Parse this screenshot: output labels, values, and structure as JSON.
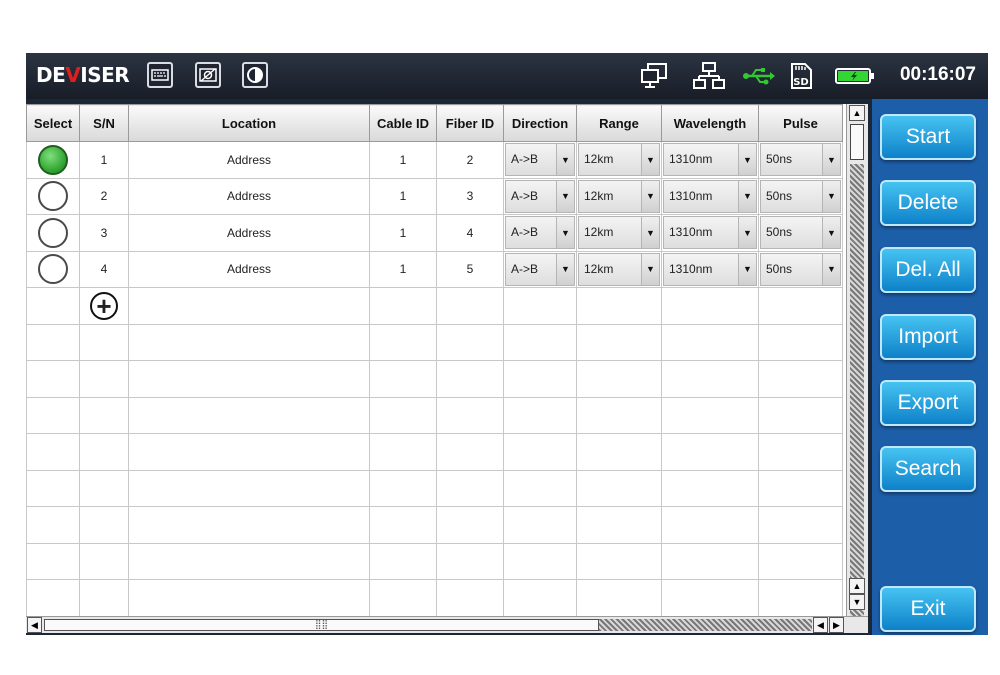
{
  "app": {
    "brand_prefix": "DE",
    "brand_mark": "V",
    "brand_suffix": "ISER",
    "clock": "00:16:07"
  },
  "colors": {
    "brand_red": "#e01e1e",
    "sidebar": "#1d5ea8",
    "button": "#2aa7e6",
    "selected": "#2ba02b",
    "usb_icon": "#32c832",
    "battery_fill": "#33d633"
  },
  "toolbar": {
    "icons": [
      "keyboard-icon",
      "screenshot-icon",
      "contrast-icon"
    ]
  },
  "status": {
    "icons": [
      "display-icon",
      "network-icon",
      "usb-icon",
      "sd-card-icon",
      "battery-icon"
    ],
    "sd_label": "SD"
  },
  "table": {
    "headers": {
      "select": "Select",
      "sn": "S/N",
      "location": "Location",
      "cable_id": "Cable ID",
      "fiber_id": "Fiber ID",
      "direction": "Direction",
      "range": "Range",
      "wavelength": "Wavelength",
      "pulse": "Pulse"
    },
    "rows": [
      {
        "selected": true,
        "sn": "1",
        "location": "Address",
        "cable_id": "1",
        "fiber_id": "2",
        "direction": "A->B",
        "range": "12km",
        "wavelength": "1310nm",
        "pulse": "50ns"
      },
      {
        "selected": false,
        "sn": "2",
        "location": "Address",
        "cable_id": "1",
        "fiber_id": "3",
        "direction": "A->B",
        "range": "12km",
        "wavelength": "1310nm",
        "pulse": "50ns"
      },
      {
        "selected": false,
        "sn": "3",
        "location": "Address",
        "cable_id": "1",
        "fiber_id": "4",
        "direction": "A->B",
        "range": "12km",
        "wavelength": "1310nm",
        "pulse": "50ns"
      },
      {
        "selected": false,
        "sn": "4",
        "location": "Address",
        "cable_id": "1",
        "fiber_id": "5",
        "direction": "A->B",
        "range": "12km",
        "wavelength": "1310nm",
        "pulse": "50ns"
      }
    ],
    "add_symbol": "+"
  },
  "sidebar": {
    "start": "Start",
    "delete": "Delete",
    "del_all": "Del. All",
    "import": "Import",
    "export": "Export",
    "search": "Search",
    "exit": "Exit"
  }
}
